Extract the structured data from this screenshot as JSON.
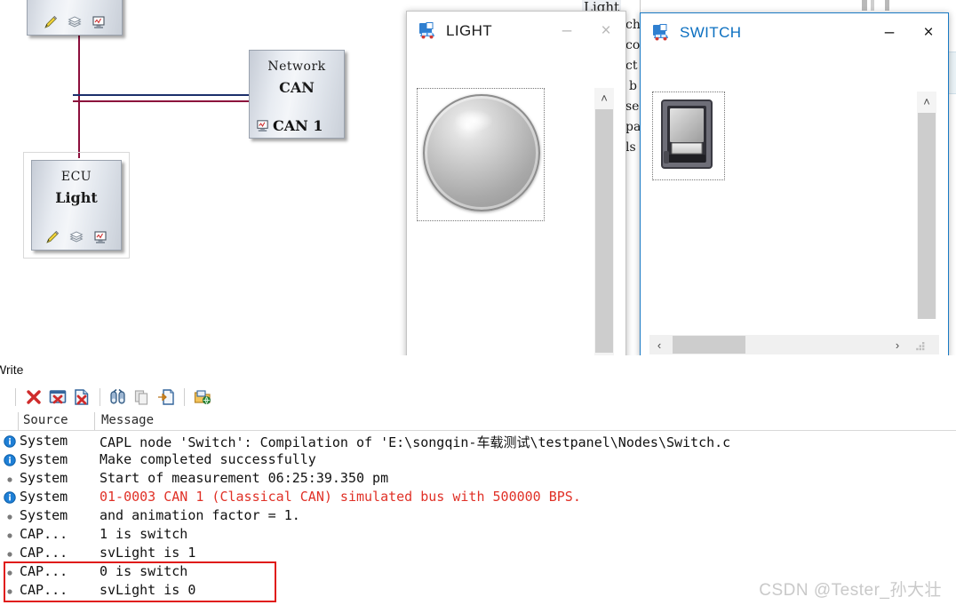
{
  "simulation_setup": {
    "nodes": [
      {
        "type": "",
        "name": "",
        "icons": [
          "pencil-icon",
          "layers-icon",
          "monitor-icon"
        ]
      },
      {
        "type": "Network",
        "name": "CAN",
        "bus_label": "CAN 1",
        "icons": [
          "monitor-icon"
        ]
      },
      {
        "type": "ECU",
        "name": "Light",
        "icons": [
          "pencil-icon",
          "layers-icon",
          "monitor-icon"
        ]
      }
    ],
    "background_tab_label": "Light",
    "background_text_fragments": [
      "ch",
      "co",
      "ct",
      "b",
      "se",
      "pa",
      "ls"
    ]
  },
  "light_panel": {
    "title": "LIGHT",
    "icon": "vector-panel-icon",
    "minimize_label": "‒",
    "close_label": "×",
    "control": "lamp-indicator",
    "lamp_state": "off",
    "scroll_up_label": "˄",
    "scroll_down_label": "˅",
    "scroll_left_label": "‹",
    "scroll_right_label": "›"
  },
  "switch_panel": {
    "title": "SWITCH",
    "icon": "vector-panel-icon",
    "minimize_label": "‒",
    "close_label": "×",
    "control": "rocker-switch",
    "switch_state": "off",
    "scroll_up_label": "˄",
    "scroll_down_label": "˅",
    "scroll_left_label": "‹",
    "scroll_right_label": "›"
  },
  "write_window": {
    "title": "Write",
    "toolbar": [
      {
        "name": "clear-all-icon",
        "label": ""
      },
      {
        "name": "clear-window-icon",
        "label": ""
      },
      {
        "name": "clear-file-icon",
        "label": ""
      },
      {
        "name": "find-icon",
        "label": ""
      },
      {
        "name": "copy-icon",
        "label": ""
      },
      {
        "name": "export-icon",
        "label": ""
      },
      {
        "name": "open-folder-icon",
        "label": ""
      }
    ],
    "columns": [
      "Source",
      "Message"
    ],
    "rows": [
      {
        "icon": "info-icon",
        "source": "System",
        "message": "CAPL node 'Switch': Compilation of 'E:\\songqin-车载测试\\testpanel\\Nodes\\Switch.c",
        "color": "#111111"
      },
      {
        "icon": "info-icon",
        "source": "System",
        "message": "Make completed successfully",
        "color": "#111111"
      },
      {
        "icon": "bullet-icon",
        "source": "System",
        "message": "Start of measurement 06:25:39.350 pm",
        "color": "#111111"
      },
      {
        "icon": "info-icon",
        "source": "System",
        "message": "01-0003 CAN 1 (Classical CAN)  simulated bus with 500000 BPS.",
        "color": "#e03127"
      },
      {
        "icon": "bullet-icon",
        "source": "System",
        "message": "  and animation factor = 1.",
        "color": "#111111"
      },
      {
        "icon": "bullet-icon",
        "source": "CAP...",
        "message": "1 is switch",
        "color": "#111111"
      },
      {
        "icon": "bullet-icon",
        "source": "CAP...",
        "message": "svLight is 1",
        "color": "#111111"
      },
      {
        "icon": "bullet-icon",
        "source": "CAP...",
        "message": "0 is switch",
        "color": "#111111"
      },
      {
        "icon": "bullet-icon",
        "source": "CAP...",
        "message": "svLight is 0",
        "color": "#111111"
      }
    ],
    "highlight_color": "#e01b18"
  },
  "watermark": {
    "text": "CSDN @Tester_孙大壮"
  },
  "colors": {
    "accent_blue": "#0b6fc0",
    "active_border": "#1a7ac4",
    "error_red": "#e03127",
    "wire_red": "#8c0f3c",
    "wire_blue": "#1c2f6b"
  }
}
